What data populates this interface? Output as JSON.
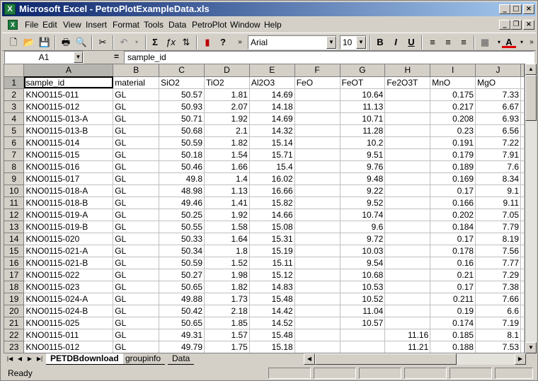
{
  "window": {
    "title": "Microsoft Excel - PetroPlotExampleData.xls"
  },
  "menubar": [
    "File",
    "Edit",
    "View",
    "Insert",
    "Format",
    "Tools",
    "Data",
    "PetroPlot",
    "Window",
    "Help"
  ],
  "toolbar": {
    "font_name": "Arial",
    "font_size": "10"
  },
  "formula_bar": {
    "cell_ref": "A1",
    "equals": "=",
    "content": "sample_id"
  },
  "columns": [
    "A",
    "B",
    "C",
    "D",
    "E",
    "F",
    "G",
    "H",
    "I",
    "J"
  ],
  "header_row": [
    "sample_id",
    "material",
    "SiO2",
    "TiO2",
    "Al2O3",
    "FeO",
    "FeOT",
    "Fe2O3T",
    "MnO",
    "MgO"
  ],
  "rows": [
    [
      "KNO0115-011",
      "GL",
      "50.57",
      "1.81",
      "14.69",
      "",
      "10.64",
      "",
      "0.175",
      "7.33"
    ],
    [
      "KNO0115-012",
      "GL",
      "50.93",
      "2.07",
      "14.18",
      "",
      "11.13",
      "",
      "0.217",
      "6.67"
    ],
    [
      "KNO0115-013-A",
      "GL",
      "50.71",
      "1.92",
      "14.69",
      "",
      "10.71",
      "",
      "0.208",
      "6.93"
    ],
    [
      "KNO0115-013-B",
      "GL",
      "50.68",
      "2.1",
      "14.32",
      "",
      "11.28",
      "",
      "0.23",
      "6.56"
    ],
    [
      "KNO0115-014",
      "GL",
      "50.59",
      "1.82",
      "15.14",
      "",
      "10.2",
      "",
      "0.191",
      "7.22"
    ],
    [
      "KNO0115-015",
      "GL",
      "50.18",
      "1.54",
      "15.71",
      "",
      "9.51",
      "",
      "0.179",
      "7.91"
    ],
    [
      "KNO0115-016",
      "GL",
      "50.46",
      "1.66",
      "15.4",
      "",
      "9.76",
      "",
      "0.189",
      "7.6"
    ],
    [
      "KNO0115-017",
      "GL",
      "49.8",
      "1.4",
      "16.02",
      "",
      "9.48",
      "",
      "0.169",
      "8.34"
    ],
    [
      "KNO0115-018-A",
      "GL",
      "48.98",
      "1.13",
      "16.66",
      "",
      "9.22",
      "",
      "0.17",
      "9.1"
    ],
    [
      "KNO0115-018-B",
      "GL",
      "49.46",
      "1.41",
      "15.82",
      "",
      "9.52",
      "",
      "0.166",
      "9.11"
    ],
    [
      "KNO0115-019-A",
      "GL",
      "50.25",
      "1.92",
      "14.66",
      "",
      "10.74",
      "",
      "0.202",
      "7.05"
    ],
    [
      "KNO0115-019-B",
      "GL",
      "50.55",
      "1.58",
      "15.08",
      "",
      "9.6",
      "",
      "0.184",
      "7.79"
    ],
    [
      "KNO0115-020",
      "GL",
      "50.33",
      "1.64",
      "15.31",
      "",
      "9.72",
      "",
      "0.17",
      "8.19"
    ],
    [
      "KNO0115-021-A",
      "GL",
      "50.34",
      "1.8",
      "15.19",
      "",
      "10.03",
      "",
      "0.178",
      "7.56"
    ],
    [
      "KNO0115-021-B",
      "GL",
      "50.59",
      "1.52",
      "15.11",
      "",
      "9.54",
      "",
      "0.16",
      "7.77"
    ],
    [
      "KNO0115-022",
      "GL",
      "50.27",
      "1.98",
      "15.12",
      "",
      "10.68",
      "",
      "0.21",
      "7.29"
    ],
    [
      "KNO0115-023",
      "GL",
      "50.65",
      "1.82",
      "14.83",
      "",
      "10.53",
      "",
      "0.17",
      "7.38"
    ],
    [
      "KNO0115-024-A",
      "GL",
      "49.88",
      "1.73",
      "15.48",
      "",
      "10.52",
      "",
      "0.211",
      "7.66"
    ],
    [
      "KNO0115-024-B",
      "GL",
      "50.42",
      "2.18",
      "14.42",
      "",
      "11.04",
      "",
      "0.19",
      "6.6"
    ],
    [
      "KNO0115-025",
      "GL",
      "50.65",
      "1.85",
      "14.52",
      "",
      "10.57",
      "",
      "0.174",
      "7.19"
    ],
    [
      "KNO0115-011",
      "GL",
      "49.31",
      "1.57",
      "15.48",
      "",
      "",
      "11.16",
      "0.185",
      "8.1"
    ],
    [
      "KNO0115-012",
      "GL",
      "49.79",
      "1.75",
      "15.18",
      "",
      "",
      "11.21",
      "0.188",
      "7.53"
    ]
  ],
  "sheet_tabs": [
    "PETDBdownload",
    "groupinfo",
    "Data"
  ],
  "active_sheet": "PETDBdownload",
  "status": "Ready"
}
